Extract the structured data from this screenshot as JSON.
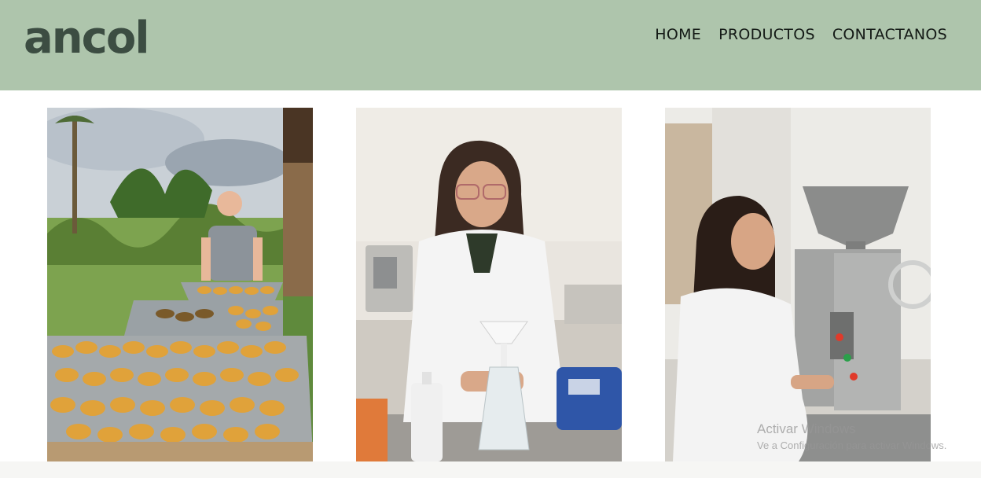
{
  "brand": {
    "logo_text": "ancol",
    "header_color": "#aec5ac",
    "logo_color": "#3c4d42"
  },
  "nav": {
    "items": [
      {
        "label": "HOME"
      },
      {
        "label": "PRODUCTOS"
      },
      {
        "label": "CONTACTANOS"
      }
    ]
  },
  "gallery": {
    "images": [
      {
        "subject": "man with trays of drying fruit pieces outdoors"
      },
      {
        "subject": "woman in lab coat holding funnel over flask"
      },
      {
        "subject": "woman in lab coat operating stainless press machine"
      }
    ]
  },
  "system_watermark": {
    "line1": "Activar Windows",
    "line2": "Ve a Configuración para activar Windows."
  }
}
